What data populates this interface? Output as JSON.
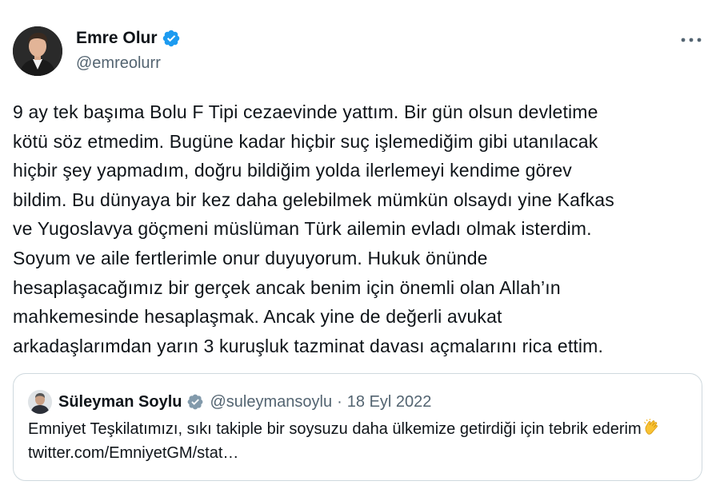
{
  "author": {
    "display_name": "Emre Olur",
    "handle": "@emreolurr",
    "verified_icon": "verified-badge-icon",
    "more_icon": "more-options-icon"
  },
  "tweet": {
    "text": "9 ay tek başıma Bolu F Tipi cezaevinde yattım. Bir gün olsun devletime\nkötü söz etmedim. Bugüne kadar hiçbir suç işlemediğim gibi utanılacak\nhiçbir şey yapmadım, doğru bildiğim yolda ilerlemeyi kendime görev\nbildim. Bu dünyaya bir kez daha gelebilmek mümkün olsaydı yine Kafkas\nve Yugoslavya göçmeni müslüman Türk ailemin evladı olmak isterdim.\nSoyum ve aile fertlerimle onur duyuyorum. Hukuk önünde\nhesaplaşacağımız bir gerçek ancak benim için önemli olan Allah’ın\nmahkemesinde hesaplaşmak. Ancak yine de değerli avukat\narkadaşlarımdan yarın 3 kuruşluk tazminat davası açmalarını rica ettim."
  },
  "quoted_tweet": {
    "display_name": "Süleyman Soylu",
    "handle": "@suleymansoylu",
    "separator": "·",
    "date": "18 Eyl 2022",
    "text_part1": "Emniyet Teşkilatımızı, sıkı takiple bir soysuzu daha ülkemize getirdiği için tebrik ederim",
    "emoji_icon": "clapping-hands-icon",
    "link": "twitter.com/EmniyetGM/stat…"
  },
  "colors": {
    "text_primary": "#0f1419",
    "text_secondary": "#536471",
    "verified_blue": "#1d9bf0",
    "border": "#cfd9de"
  }
}
